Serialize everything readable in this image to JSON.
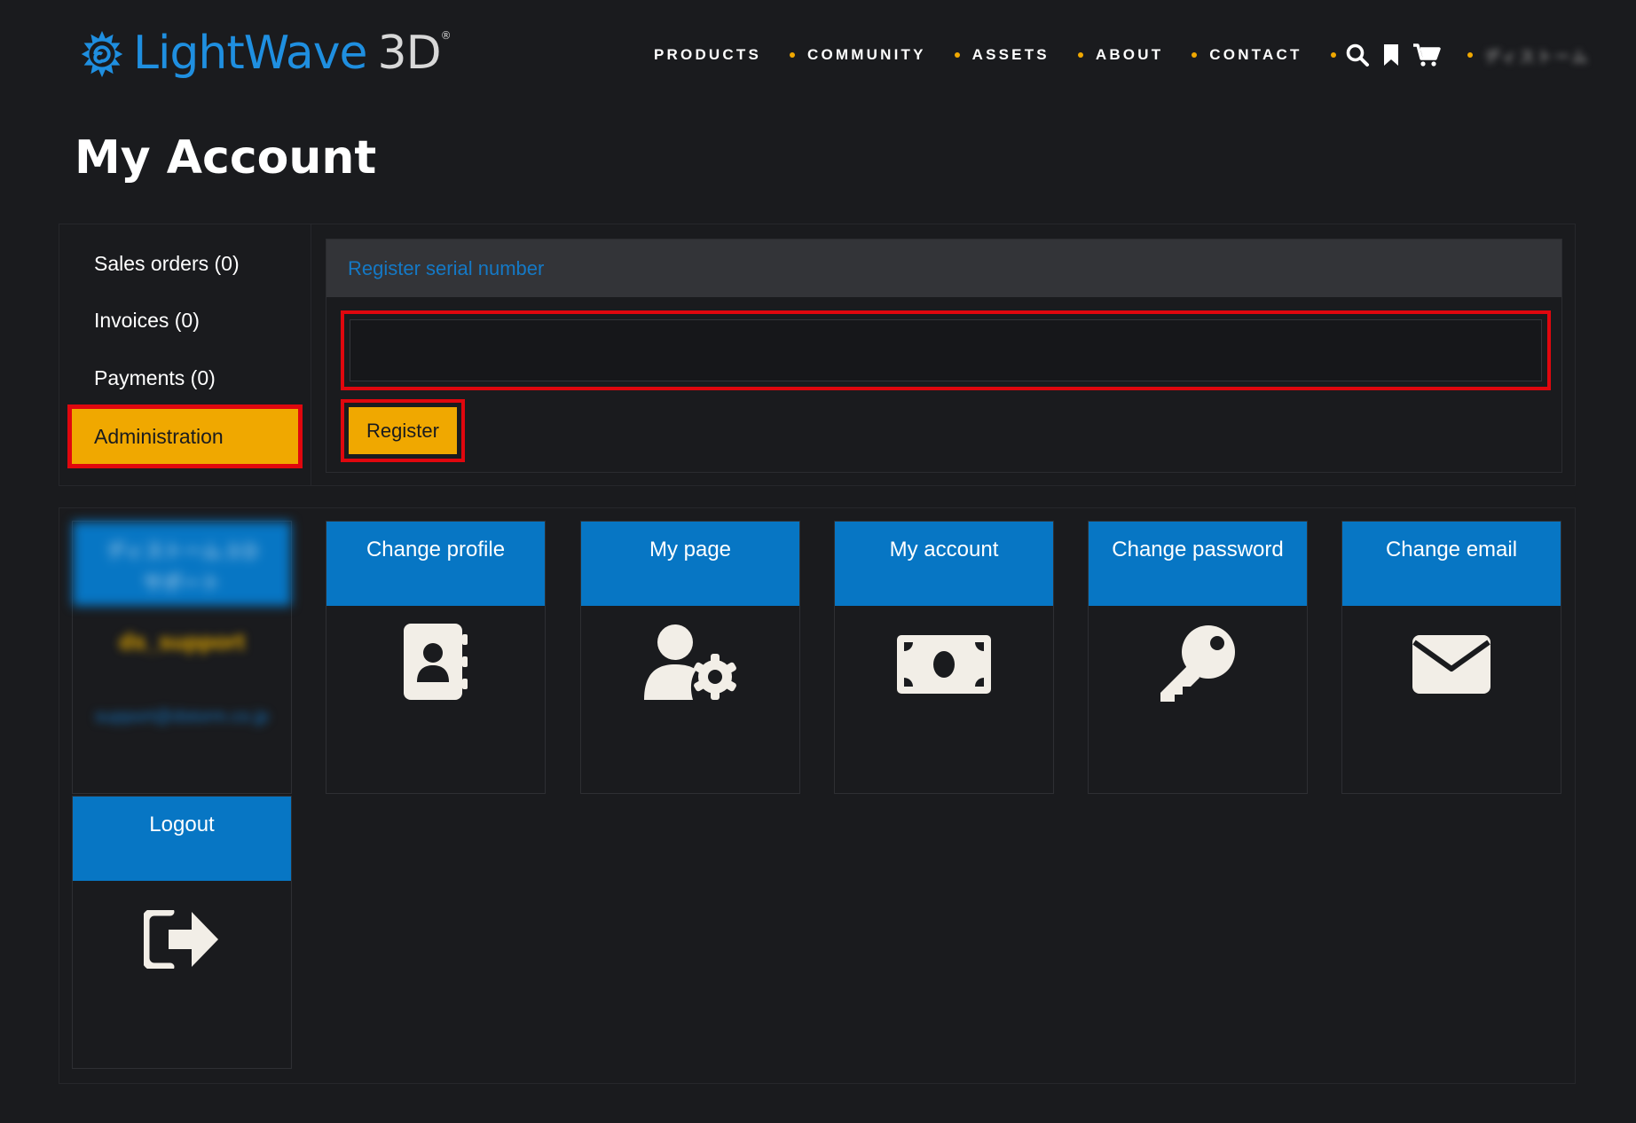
{
  "brand": {
    "logo_name": "LightWave",
    "logo_suffix": "3D",
    "logo_mark": "®"
  },
  "nav": {
    "items": [
      {
        "label": "PRODUCTS"
      },
      {
        "label": "COMMUNITY"
      },
      {
        "label": "ASSETS"
      },
      {
        "label": "ABOUT"
      },
      {
        "label": "CONTACT"
      }
    ],
    "icons": [
      "search-icon",
      "bookmark-icon",
      "cart-icon"
    ],
    "language_label": "ディストーム"
  },
  "page": {
    "title": "My Account"
  },
  "sidebar": {
    "items": [
      {
        "label": "Sales orders (0)"
      },
      {
        "label": "Invoices (0)"
      },
      {
        "label": "Payments (0)"
      },
      {
        "label": "Administration"
      }
    ],
    "active_index": 3
  },
  "register": {
    "header": "Register serial number",
    "input_value": "",
    "input_placeholder": "",
    "button_label": "Register"
  },
  "profile": {
    "name_line1": "ディストーム 3 D",
    "name_line2": "サポート",
    "username": "ds_support",
    "email": "support@dstorm.co.jp"
  },
  "tiles": [
    {
      "label": "Change profile",
      "icon": "address-book-icon"
    },
    {
      "label": "My page",
      "icon": "user-gear-icon"
    },
    {
      "label": "My account",
      "icon": "money-bill-icon"
    },
    {
      "label": "Change password",
      "icon": "key-icon"
    },
    {
      "label": "Change email",
      "icon": "envelope-icon"
    },
    {
      "label": "Logout",
      "icon": "sign-out-icon"
    }
  ],
  "colors": {
    "background": "#1a1b1e",
    "accent": "#f0a800",
    "tile_blue": "#0776c4",
    "link_blue": "#1479c6",
    "highlight_red": "#e0070e"
  }
}
